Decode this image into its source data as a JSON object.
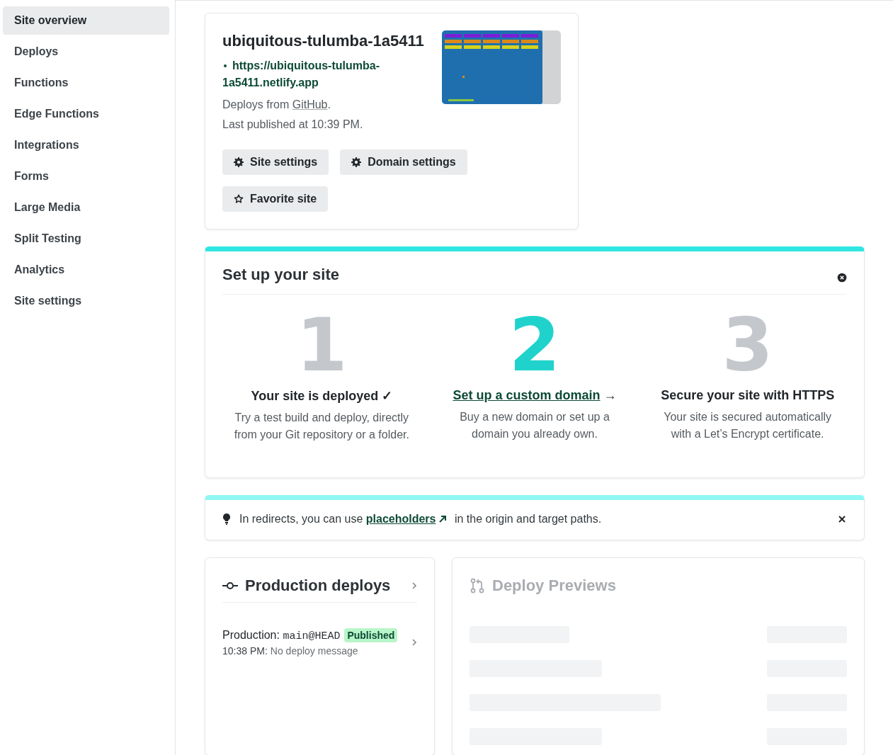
{
  "sidebar": {
    "items": [
      {
        "label": "Site overview",
        "selected": true
      },
      {
        "label": "Deploys",
        "selected": false
      },
      {
        "label": "Functions",
        "selected": false
      },
      {
        "label": "Edge Functions",
        "selected": false
      },
      {
        "label": "Integrations",
        "selected": false
      },
      {
        "label": "Forms",
        "selected": false
      },
      {
        "label": "Large Media",
        "selected": false
      },
      {
        "label": "Split Testing",
        "selected": false
      },
      {
        "label": "Analytics",
        "selected": false
      },
      {
        "label": "Site settings",
        "selected": false
      }
    ]
  },
  "site": {
    "name": "ubiquitous-tulumba-1a5411",
    "url": "https://ubiquitous-tulumba-1a5411.netlify.app",
    "deploys_from": "Deploys from",
    "provider": "GitHub",
    "provider_end": ".",
    "last_published": "Last published at 10:39 PM.",
    "buttons": [
      {
        "label": "Site settings",
        "kind": "settings"
      },
      {
        "label": "Domain settings",
        "kind": "settings"
      },
      {
        "label": "Favorite site",
        "kind": "favorite"
      }
    ]
  },
  "setup": {
    "title": "Set up your site",
    "steps": [
      {
        "number": "1",
        "kind": "done",
        "title": "Your site is deployed",
        "mark": "✓",
        "text": "Try a test build and deploy, directly from your Git repository or a folder."
      },
      {
        "number": "2",
        "kind": "link",
        "title": "Set up a custom domain",
        "mark": "→",
        "text": "Buy a new domain or set up a domain you already own."
      },
      {
        "number": "3",
        "kind": "plain",
        "title": "Secure your site with HTTPS",
        "text": "Your site is secured automatically with a Let’s Encrypt certificate."
      }
    ]
  },
  "tip": {
    "before": "In redirects, you can use",
    "link": "placeholders",
    "after": "in the origin and target paths."
  },
  "production": {
    "title": "Production deploys",
    "deploys": [
      {
        "context": "Production:",
        "ref": "main@HEAD",
        "badge": "Published",
        "time": "10:38 PM:",
        "message": "No deploy message"
      }
    ]
  },
  "previews": {
    "title": "Deploy Previews",
    "loading": true
  }
}
